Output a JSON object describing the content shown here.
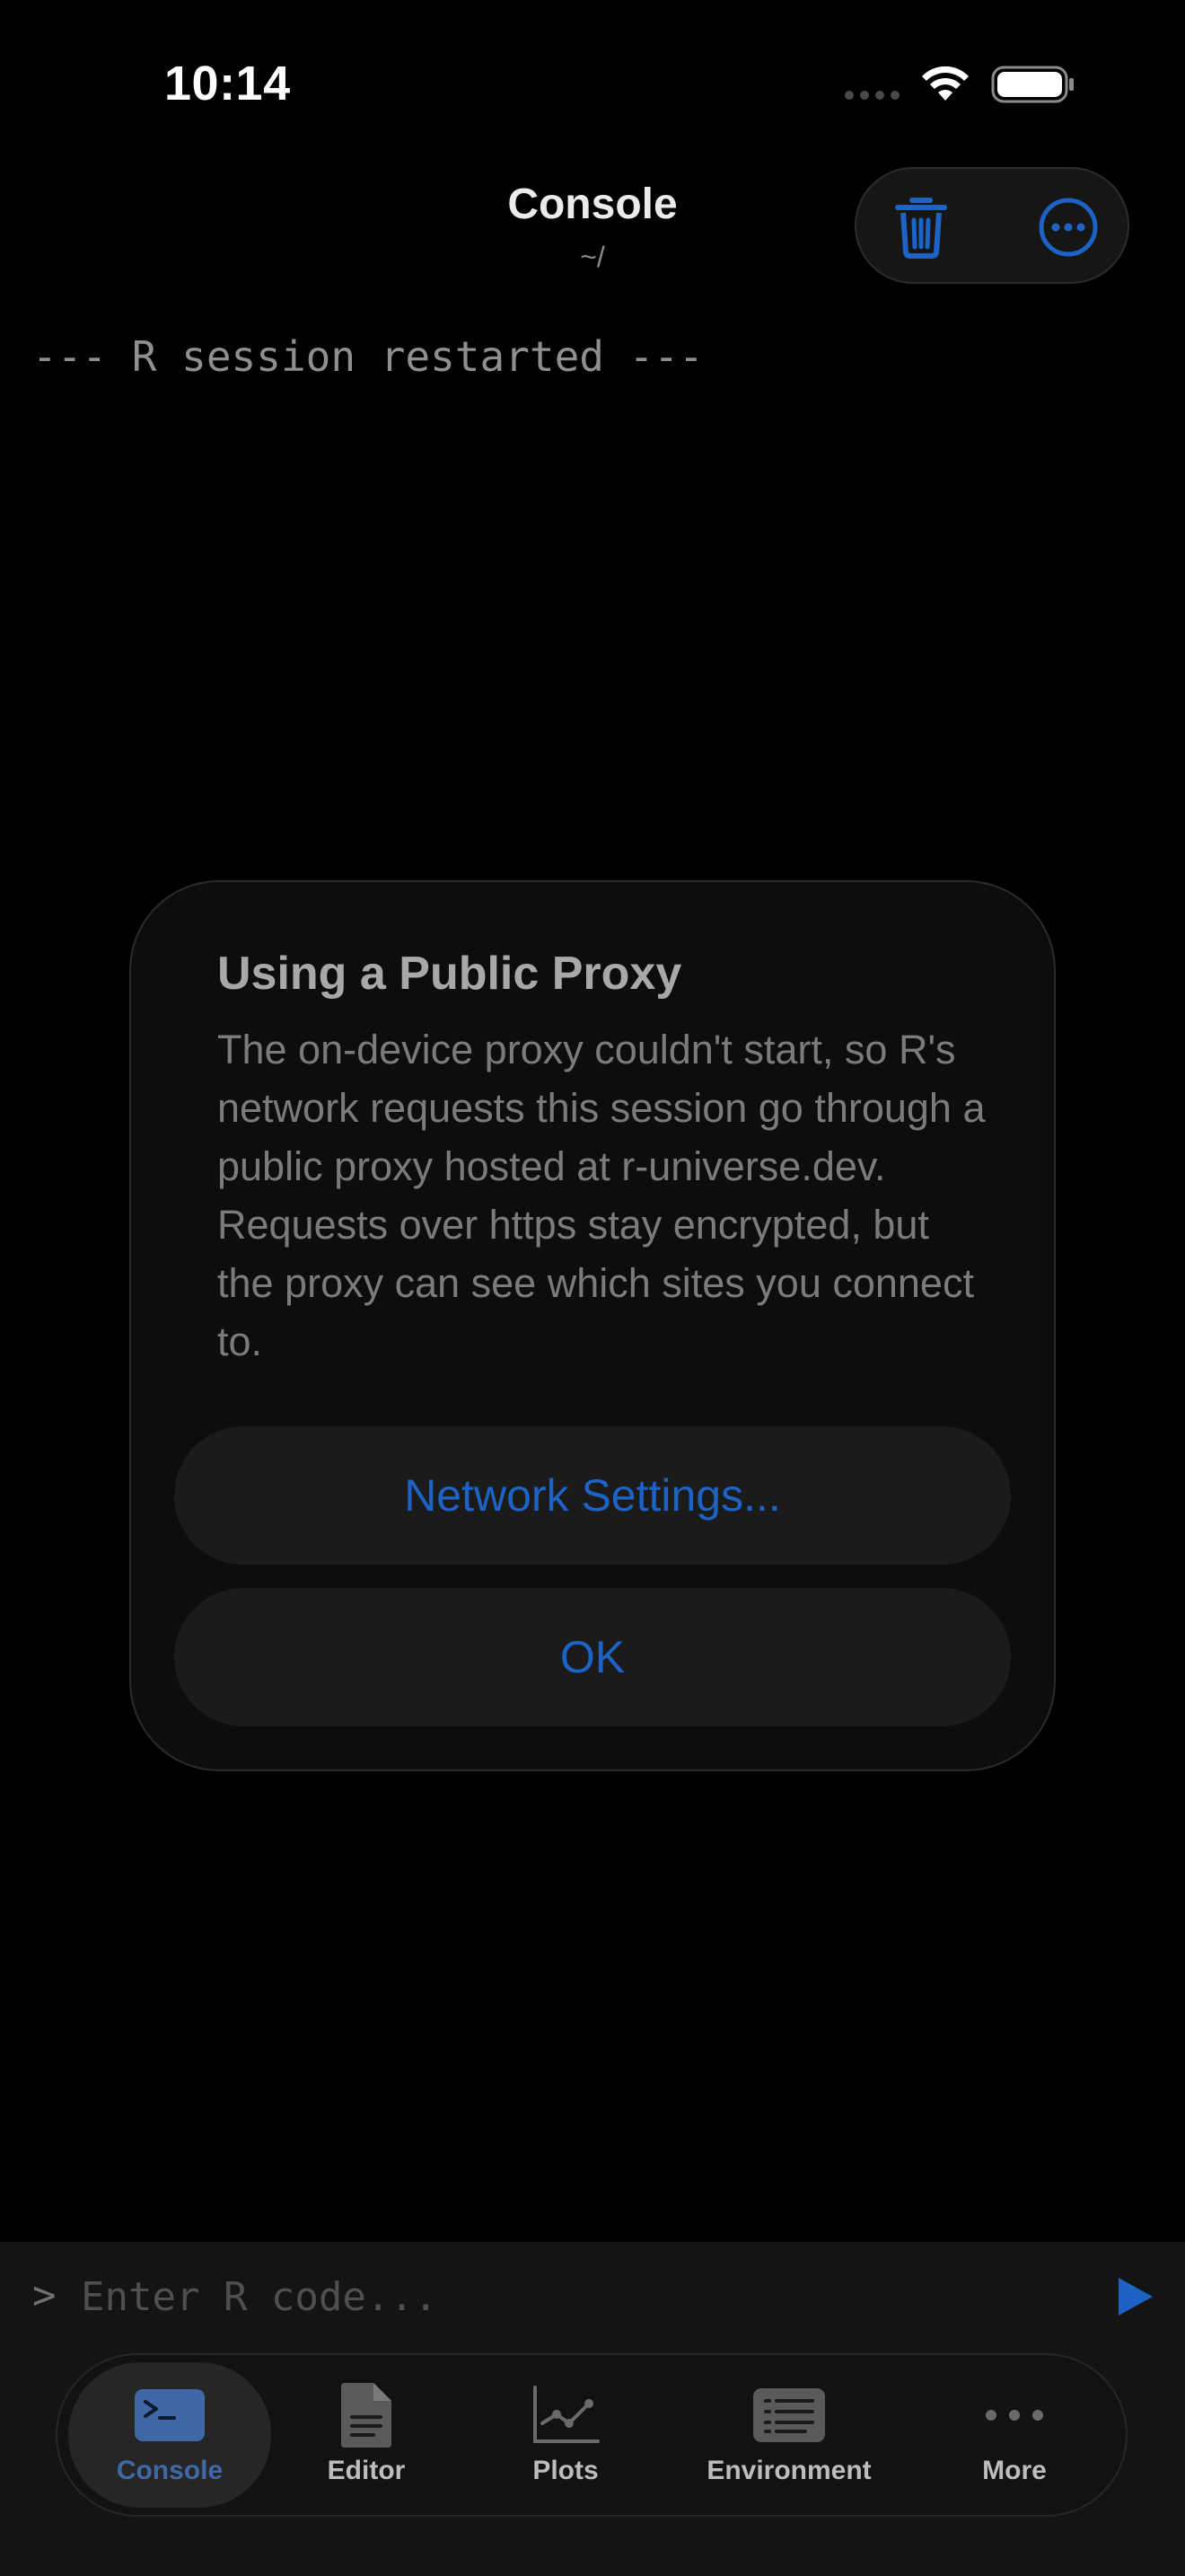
{
  "status_bar": {
    "time": "10:14"
  },
  "header": {
    "title": "Console",
    "subtitle": "~/",
    "actions": [
      {
        "icon": "trash-icon"
      },
      {
        "icon": "ellipsis-circle-icon"
      }
    ]
  },
  "console": {
    "output_line": "--- R session restarted ---"
  },
  "dialog": {
    "title": "Using a Public Proxy",
    "message": "The on-device proxy couldn't start, so R's network requests this session go through a public proxy hosted at r-universe.dev. Requests over https stay encrypted, but the proxy can see which sites you connect to.",
    "network_settings_label": "Network Settings...",
    "ok_label": "OK"
  },
  "input": {
    "prompt": ">",
    "value": "",
    "placeholder": "Enter R code..."
  },
  "tabs": [
    {
      "label": "Console",
      "icon": "terminal-icon",
      "active": true
    },
    {
      "label": "Editor",
      "icon": "document-icon",
      "active": false
    },
    {
      "label": "Plots",
      "icon": "chart-line-icon",
      "active": false
    },
    {
      "label": "Environment",
      "icon": "list-icon",
      "active": false
    },
    {
      "label": "More",
      "icon": "more-dots-icon",
      "active": false
    }
  ],
  "colors": {
    "accent": "#1d63c6",
    "active_tab_label": "#3f68a6",
    "background": "#000000"
  }
}
